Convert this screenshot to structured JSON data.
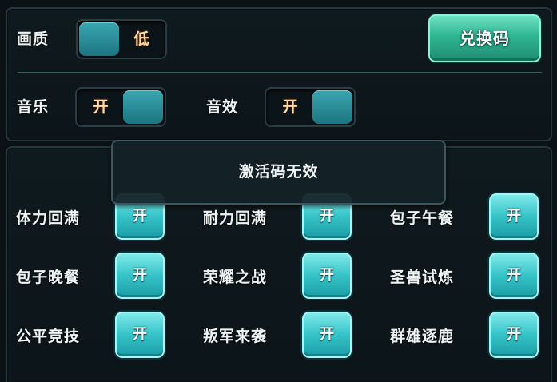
{
  "settings": {
    "quality": {
      "label": "画质",
      "value": "低"
    },
    "music": {
      "label": "音乐",
      "value": "开"
    },
    "sound": {
      "label": "音效",
      "value": "开"
    },
    "redeem_label": "兑换码"
  },
  "toast_message": "激活码无效",
  "activities": [
    {
      "label": "体力回满",
      "button": "开"
    },
    {
      "label": "耐力回满",
      "button": "开"
    },
    {
      "label": "包子午餐",
      "button": "开"
    },
    {
      "label": "包子晚餐",
      "button": "开"
    },
    {
      "label": "荣耀之战",
      "button": "开"
    },
    {
      "label": "圣兽试炼",
      "button": "开"
    },
    {
      "label": "公平竞技",
      "button": "开"
    },
    {
      "label": "叛军来袭",
      "button": "开"
    },
    {
      "label": "群雄逐鹿",
      "button": "开"
    }
  ],
  "colors": {
    "background": "#0b1216",
    "accent_teal": "#35c3c7",
    "redeem_green": "#2fb592",
    "toggle_text": "#ffd9a8"
  }
}
